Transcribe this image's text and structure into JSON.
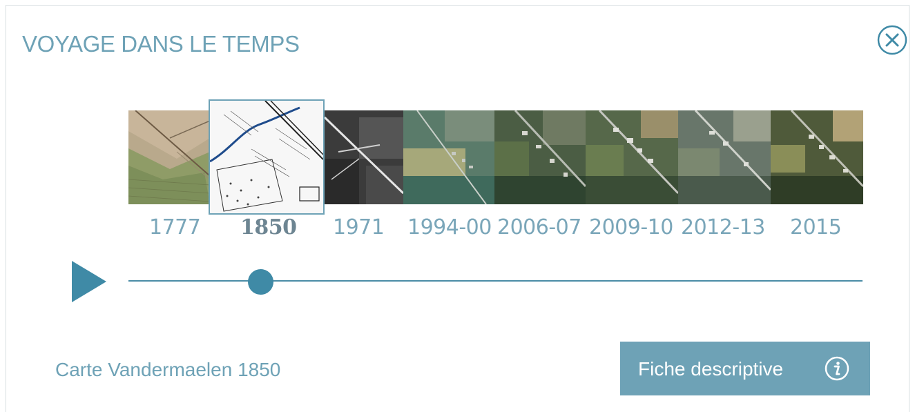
{
  "panel": {
    "title": "VOYAGE DANS LE TEMPS",
    "close_icon": "close-circle-x-icon"
  },
  "timeline": {
    "selected_index": 1,
    "items": [
      {
        "year": "1777"
      },
      {
        "year": "1850"
      },
      {
        "year": "1971"
      },
      {
        "year": "1994-00"
      },
      {
        "year": "2006-07"
      },
      {
        "year": "2009-10"
      },
      {
        "year": "2012-13"
      },
      {
        "year": "2015"
      }
    ],
    "slider_position": 0.18,
    "play_icon": "play-icon"
  },
  "caption": "Carte Vandermaelen 1850",
  "description_button": {
    "label": "Fiche descriptive",
    "icon": "info-icon"
  },
  "colors": {
    "accent": "#6ea2b6",
    "slider": "#3f8aa6",
    "year_text": "#7aa6b9",
    "year_selected": "#6d8592"
  }
}
